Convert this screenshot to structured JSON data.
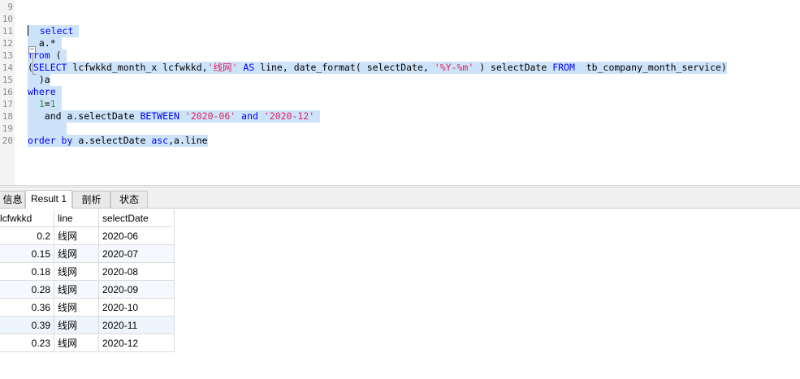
{
  "editor": {
    "lines": [
      {
        "no": "9",
        "code": [],
        "selected": false
      },
      {
        "no": "10",
        "code": [],
        "selected": false
      },
      {
        "no": "11",
        "code": [
          {
            "t": "  select ",
            "c": "kw"
          }
        ],
        "selected": true,
        "caret": true
      },
      {
        "no": "12",
        "code": [
          {
            "t": "  a.* ",
            "c": ""
          }
        ],
        "selected": true
      },
      {
        "no": "13",
        "code": [
          {
            "t": "from",
            "c": "kw"
          },
          {
            "t": " ( ",
            "c": ""
          }
        ],
        "selected": true
      },
      {
        "no": "14",
        "code": [
          {
            "t": "(",
            "c": ""
          },
          {
            "t": "SELECT",
            "c": "kw"
          },
          {
            "t": " lcfwkkd_month_x lcfwkkd,",
            "c": ""
          },
          {
            "t": "'线网'",
            "c": "str"
          },
          {
            "t": " ",
            "c": ""
          },
          {
            "t": "AS",
            "c": "kw"
          },
          {
            "t": " line, date_format( selectDate, ",
            "c": ""
          },
          {
            "t": "'%Y-%m'",
            "c": "str"
          },
          {
            "t": " ) selectDate ",
            "c": ""
          },
          {
            "t": "FROM",
            "c": "kw"
          },
          {
            "t": "  tb_company_month_service)",
            "c": ""
          }
        ],
        "selected": true
      },
      {
        "no": "15",
        "code": [
          {
            "t": "  )a",
            "c": ""
          }
        ],
        "selected": true
      },
      {
        "no": "16",
        "code": [
          {
            "t": "where",
            "c": "kw"
          },
          {
            "t": " ",
            "c": ""
          }
        ],
        "selected": true
      },
      {
        "no": "17",
        "code": [
          {
            "t": "  ",
            "c": ""
          },
          {
            "t": "1",
            "c": "num"
          },
          {
            "t": "=",
            "c": ""
          },
          {
            "t": "1",
            "c": "num"
          },
          {
            "t": " ",
            "c": ""
          }
        ],
        "selected": true
      },
      {
        "no": "18",
        "code": [
          {
            "t": "   and a.selectDate ",
            "c": ""
          },
          {
            "t": "BETWEEN",
            "c": "kw"
          },
          {
            "t": " ",
            "c": ""
          },
          {
            "t": "'2020-06'",
            "c": "str"
          },
          {
            "t": " ",
            "c": ""
          },
          {
            "t": "and",
            "c": "kw"
          },
          {
            "t": " ",
            "c": ""
          },
          {
            "t": "'2020-12'",
            "c": "str"
          },
          {
            "t": " ",
            "c": ""
          }
        ],
        "selected": true
      },
      {
        "no": "19",
        "code": [
          {
            "t": "       ",
            "c": ""
          }
        ],
        "selected": true
      },
      {
        "no": "20",
        "code": [
          {
            "t": "order by",
            "c": "kw"
          },
          {
            "t": " a.selectDate ",
            "c": ""
          },
          {
            "t": "asc",
            "c": "kw"
          },
          {
            "t": ",a.line",
            "c": ""
          }
        ],
        "selected": true
      }
    ]
  },
  "tabs": [
    {
      "label": "信息",
      "active": false
    },
    {
      "label": "Result 1",
      "active": true
    },
    {
      "label": "剖析",
      "active": false
    },
    {
      "label": "状态",
      "active": false
    }
  ],
  "result": {
    "columns": [
      "lcfwkkd",
      "line",
      "selectDate"
    ],
    "rows": [
      [
        "0.2",
        "线网",
        "2020-06"
      ],
      [
        "0.15",
        "线网",
        "2020-07"
      ],
      [
        "0.18",
        "线网",
        "2020-08"
      ],
      [
        "0.28",
        "线网",
        "2020-09"
      ],
      [
        "0.36",
        "线网",
        "2020-10"
      ],
      [
        "0.39",
        "线网",
        "2020-11"
      ],
      [
        "0.23",
        "线网",
        "2020-12"
      ]
    ]
  }
}
